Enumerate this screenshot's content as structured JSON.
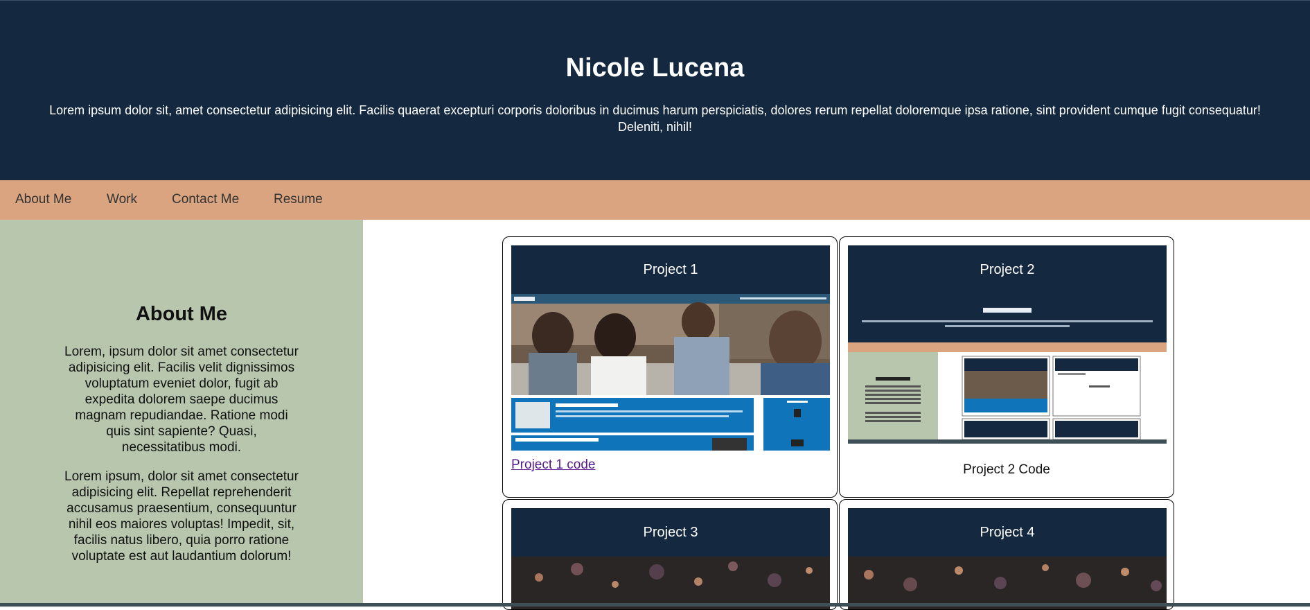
{
  "header": {
    "title": "Nicole Lucena",
    "intro": "Lorem ipsum dolor sit, amet consectetur adipisicing elit. Facilis quaerat excepturi corporis doloribus in ducimus harum perspiciatis, dolores rerum repellat doloremque ipsa ratione, sint provident cumque fugit consequatur! Deleniti, nihil!"
  },
  "nav": {
    "items": [
      {
        "label": "About Me"
      },
      {
        "label": "Work"
      },
      {
        "label": "Contact Me"
      },
      {
        "label": "Resume"
      }
    ]
  },
  "about": {
    "title": "About Me",
    "paragraph1": "Lorem, ipsum dolor sit amet consectetur adipisicing elit. Facilis velit dignissimos voluptatum eveniet dolor, fugit ab expedita dolorem saepe ducimus magnam repudiandae. Ratione modi quis sint sapiente? Quasi, necessitatibus modi.",
    "paragraph2": "Lorem ipsum, dolor sit amet consectetur adipisicing elit. Repellat reprehenderit accusamus praesentium, consequuntur nihil eos maiores voluptas! Impedit, sit, facilis natus libero, quia porro ratione voluptate est aut laudantium dolorum!"
  },
  "projects": [
    {
      "title": "Project 1",
      "link_label": "Project 1 code"
    },
    {
      "title": "Project 2",
      "caption": "Project 2 Code"
    },
    {
      "title": "Project 3"
    },
    {
      "title": "Project 4"
    }
  ],
  "colors": {
    "header_bg": "#142840",
    "nav_bg": "#d9a47f",
    "sidebar_bg": "#b8c6ad",
    "link": "#551a8b"
  }
}
